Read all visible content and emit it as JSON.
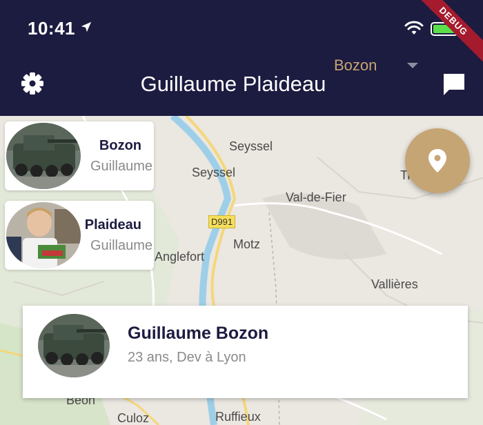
{
  "status_bar": {
    "time": "10:41",
    "icons": [
      "location-arrow-icon",
      "wifi-icon",
      "battery-icon"
    ]
  },
  "debug_banner": "DEBUG",
  "header": {
    "title": "Guillaume Plaideau",
    "settings_icon": "gear-icon",
    "chat_icon": "chat-bubble-icon",
    "dropdown": {
      "selected": "Bozon"
    }
  },
  "colors": {
    "navy": "#1c1b40",
    "gold": "#c6a574",
    "debug_red": "#a51b2e",
    "battery_green": "#5be04a"
  },
  "map": {
    "places": [
      "Seyssel",
      "Seyssel",
      "Val-de-Fier",
      "Motz",
      "Anglefort",
      "Vallières",
      "Culoz",
      "Ruffieux",
      "Béon",
      "Tr"
    ],
    "road_badge": "D991"
  },
  "profiles": [
    {
      "lastname": "Bozon",
      "firstname": "Guillaume",
      "photo": "tank-photo"
    },
    {
      "lastname": "Plaideau",
      "firstname": "Guillaume",
      "photo": "person-photo"
    }
  ],
  "fab": {
    "icon": "map-pin-icon"
  },
  "selected_card": {
    "name": "Guillaume Bozon",
    "meta": "23 ans, Dev à Lyon"
  }
}
